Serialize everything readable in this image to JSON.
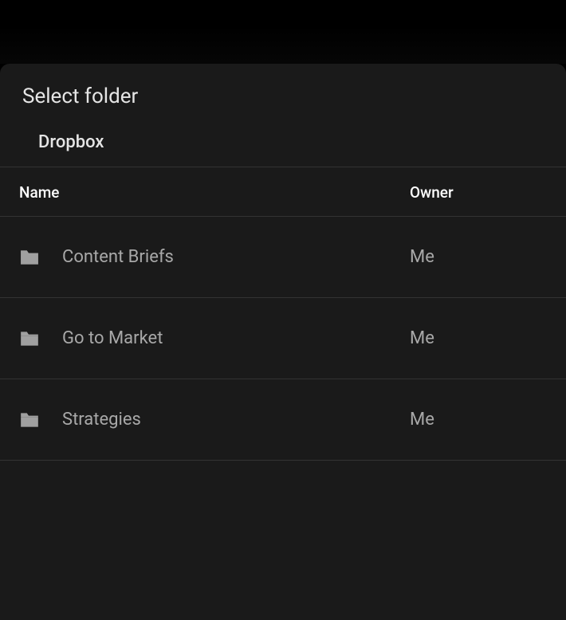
{
  "modal": {
    "title": "Select folder",
    "breadcrumb": "Dropbox"
  },
  "table": {
    "headers": {
      "name": "Name",
      "owner": "Owner"
    },
    "rows": [
      {
        "name": "Content Briefs",
        "owner": "Me"
      },
      {
        "name": "Go to Market",
        "owner": "Me"
      },
      {
        "name": "Strategies",
        "owner": "Me"
      }
    ]
  }
}
